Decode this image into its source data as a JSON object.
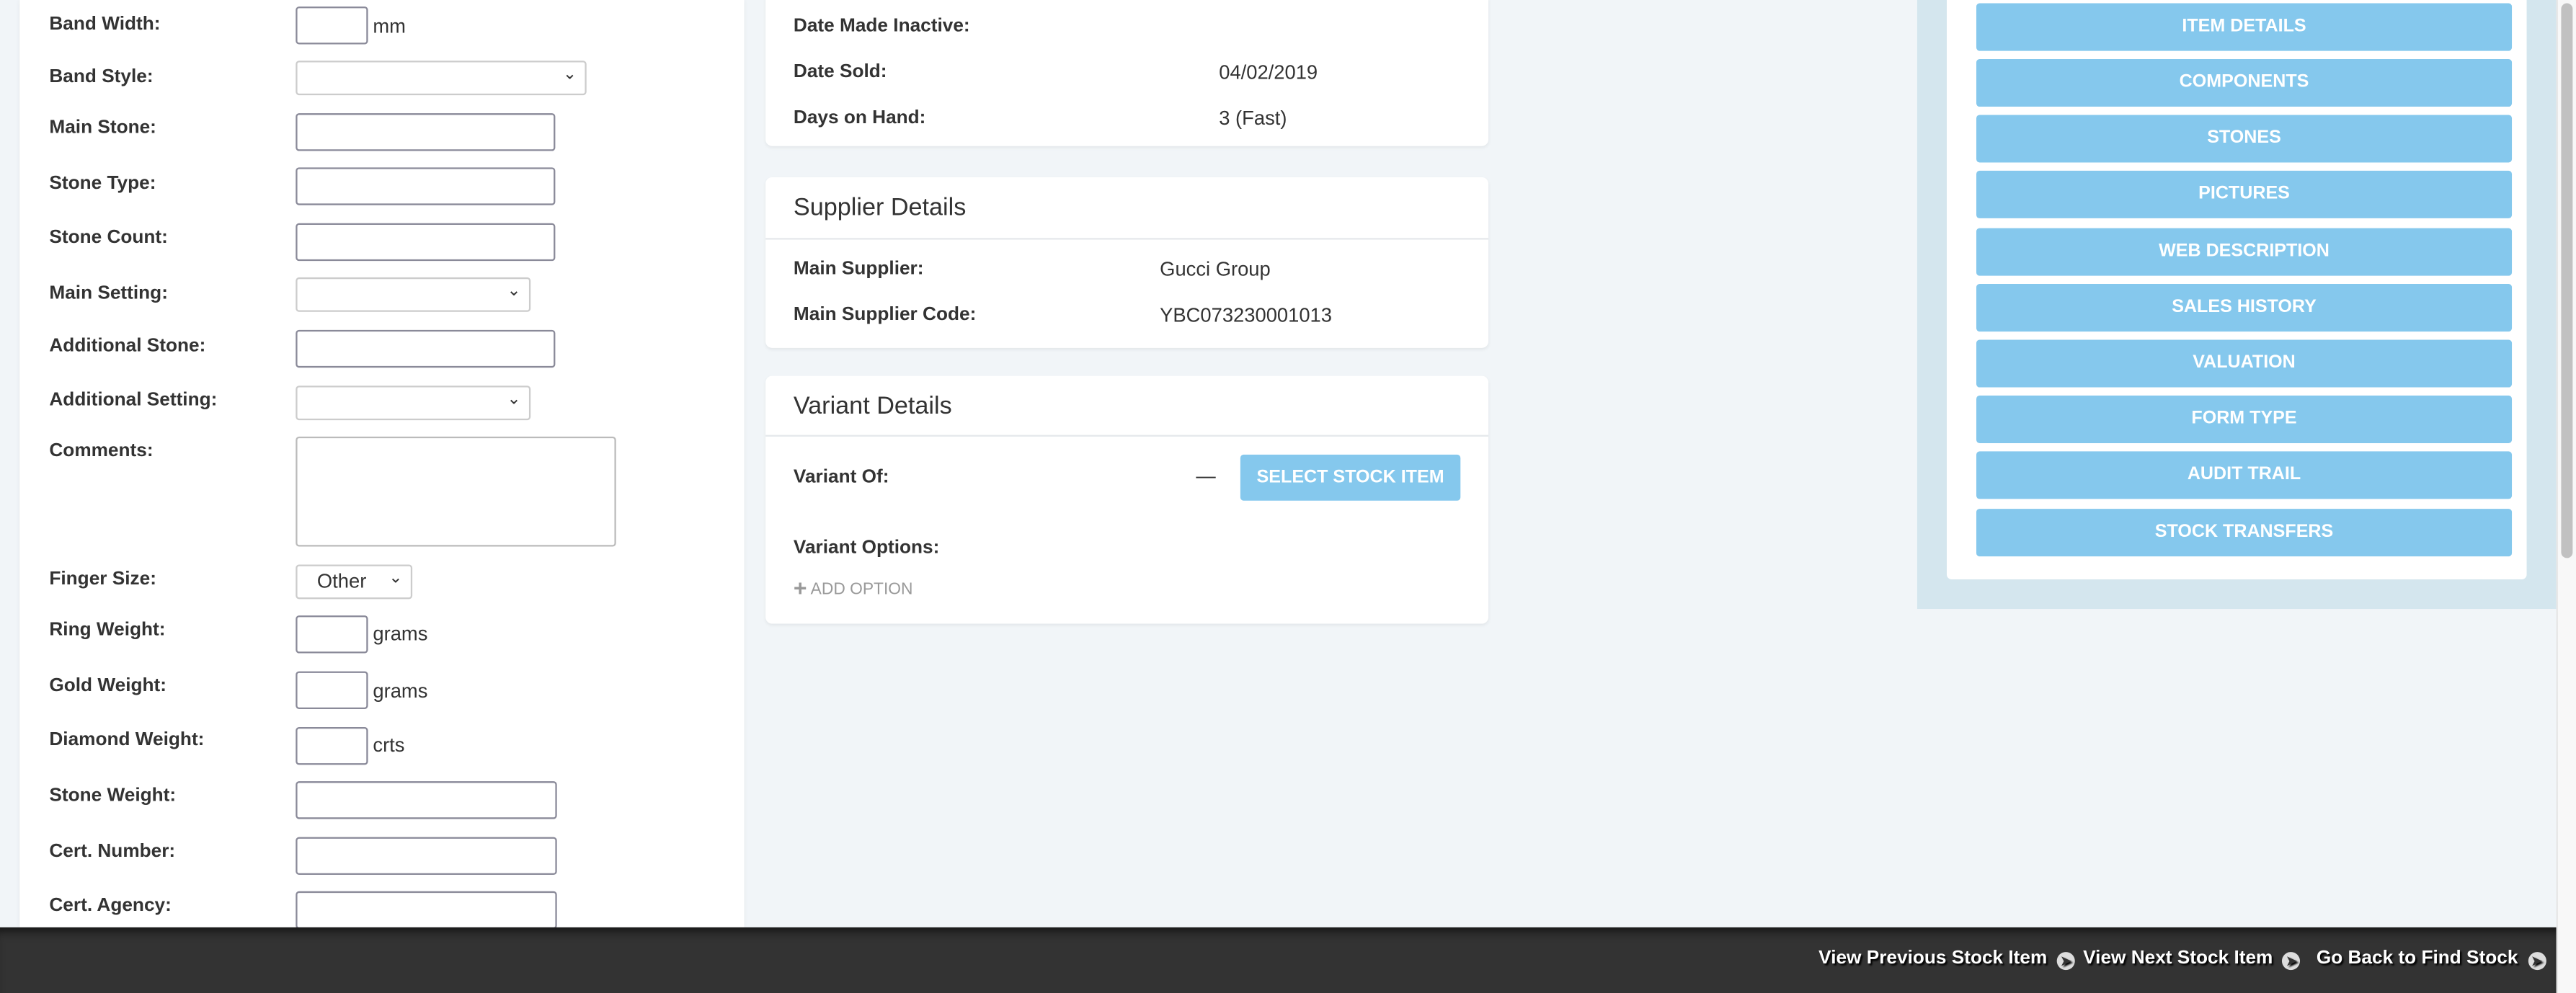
{
  "left_form": {
    "band_width": {
      "label": "Band Width:",
      "value": "",
      "unit": "mm"
    },
    "band_style": {
      "label": "Band Style:",
      "value": ""
    },
    "main_stone": {
      "label": "Main Stone:",
      "value": ""
    },
    "stone_type": {
      "label": "Stone Type:",
      "value": ""
    },
    "stone_count": {
      "label": "Stone Count:",
      "value": ""
    },
    "main_setting": {
      "label": "Main Setting:",
      "value": ""
    },
    "additional_stone": {
      "label": "Additional Stone:",
      "value": ""
    },
    "additional_setting": {
      "label": "Additional Setting:",
      "value": ""
    },
    "comments": {
      "label": "Comments:",
      "value": ""
    },
    "finger_size": {
      "label": "Finger Size:",
      "value": "Other"
    },
    "ring_weight": {
      "label": "Ring Weight:",
      "value": "",
      "unit": "grams"
    },
    "gold_weight": {
      "label": "Gold Weight:",
      "value": "",
      "unit": "grams"
    },
    "diamond_weight": {
      "label": "Diamond Weight:",
      "value": "",
      "unit": "crts"
    },
    "stone_weight": {
      "label": "Stone Weight:",
      "value": ""
    },
    "cert_number": {
      "label": "Cert. Number:",
      "value": ""
    },
    "cert_agency": {
      "label": "Cert. Agency:",
      "value": ""
    }
  },
  "dates_card": {
    "rows": [
      {
        "label": "Date Made Inactive:",
        "value": ""
      },
      {
        "label": "Date Sold:",
        "value": "04/02/2019"
      },
      {
        "label": "Days on Hand:",
        "value": "3 (Fast)"
      }
    ]
  },
  "supplier_card": {
    "title": "Supplier Details",
    "rows": [
      {
        "label": "Main Supplier:",
        "value": "Gucci Group"
      },
      {
        "label": "Main Supplier Code:",
        "value": "YBC073230001013"
      }
    ]
  },
  "variant_card": {
    "title": "Variant Details",
    "variant_of_label": "Variant Of:",
    "variant_of_value": "—",
    "select_button": "SELECT STOCK ITEM",
    "options_label": "Variant Options:",
    "add_option": "ADD OPTION"
  },
  "side_nav": {
    "items": [
      "ITEM DETAILS",
      "COMPONENTS",
      "STONES",
      "PICTURES",
      "WEB DESCRIPTION",
      "SALES HISTORY",
      "VALUATION",
      "FORM TYPE",
      "AUDIT TRAIL",
      "STOCK TRANSFERS"
    ]
  },
  "footer": {
    "prev": "View Previous Stock Item",
    "next": "View Next Stock Item",
    "back": "Go Back to Find Stock"
  },
  "colors": {
    "accent": "#85c8ed",
    "footer_bg": "#333333",
    "side_panel_bg": "#d4e6ee",
    "page_bg": "#f1f5f8"
  }
}
